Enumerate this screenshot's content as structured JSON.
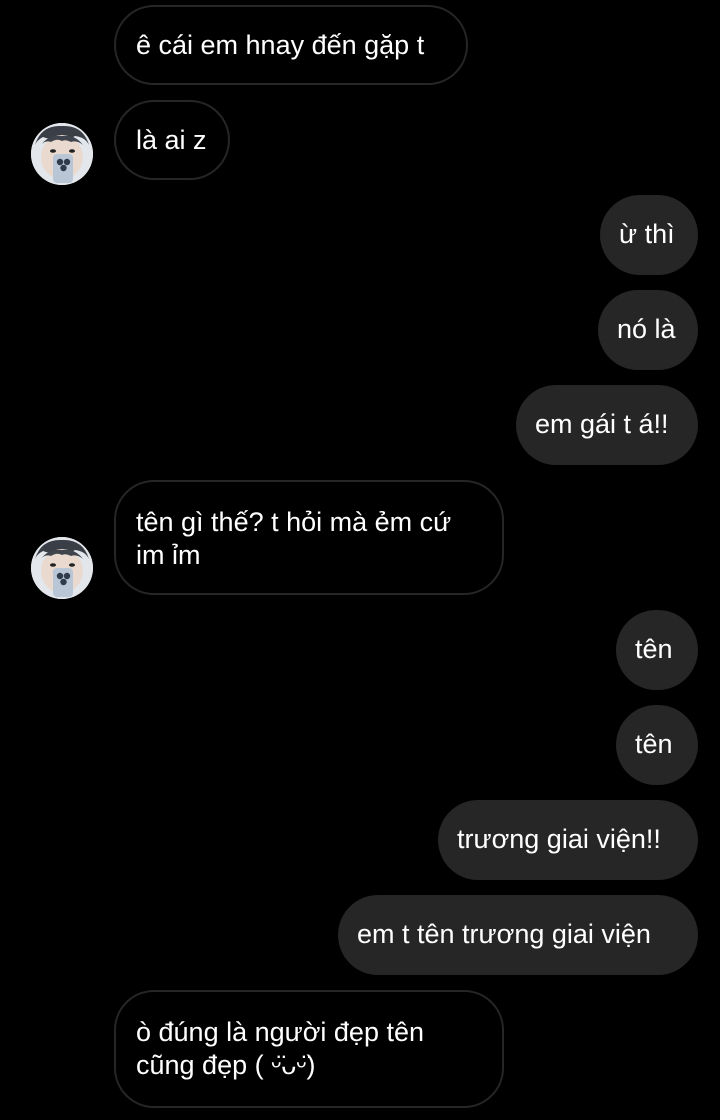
{
  "messages": [
    {
      "id": "m1",
      "side": "in",
      "lines": [
        "ê cái em hnay đến gặp t"
      ]
    },
    {
      "id": "m2",
      "side": "in",
      "lines": [
        "là ai z"
      ],
      "avatar": "contact-avatar-icon"
    },
    {
      "id": "m3",
      "side": "out",
      "lines": [
        "ừ thì"
      ]
    },
    {
      "id": "m4",
      "side": "out",
      "lines": [
        "nó là"
      ]
    },
    {
      "id": "m5",
      "side": "out",
      "lines": [
        "em gái t á!!"
      ]
    },
    {
      "id": "m6",
      "side": "in",
      "lines": [
        "tên gì thế? t hỏi mà ẻm cứ",
        "im ỉm"
      ],
      "avatar": "contact-avatar-icon"
    },
    {
      "id": "m7",
      "side": "out",
      "lines": [
        "tên"
      ]
    },
    {
      "id": "m8",
      "side": "out",
      "lines": [
        "tên"
      ]
    },
    {
      "id": "m9",
      "side": "out",
      "lines": [
        "trương giai viện!!"
      ]
    },
    {
      "id": "m10",
      "side": "out",
      "lines": [
        "em t tên trương giai viện"
      ]
    },
    {
      "id": "m11",
      "side": "in",
      "lines": [
        "ò đúng là người đẹp tên",
        "cũng đẹp ( ᵕ̈ᴗᵕ̈)"
      ]
    }
  ],
  "colors": {
    "background": "#000000",
    "outgoing_bubble": "#262626",
    "incoming_border": "#262626",
    "text": "#ffffff"
  }
}
